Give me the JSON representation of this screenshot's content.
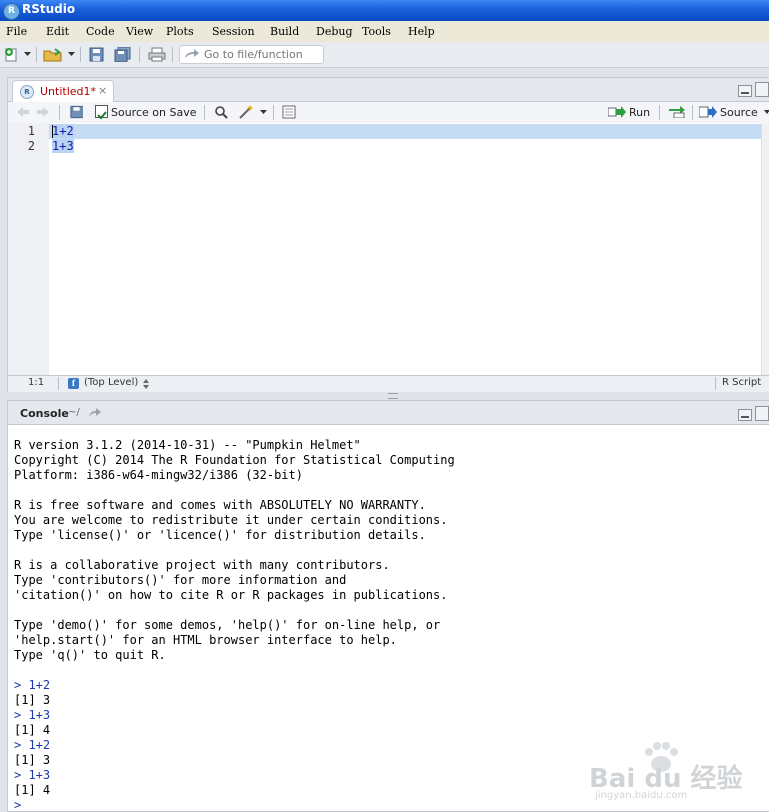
{
  "window": {
    "title": "RStudio",
    "app_icon_letter": "R"
  },
  "menu": [
    "File",
    "Edit",
    "Code",
    "View",
    "Plots",
    "Session",
    "Build",
    "Debug",
    "Tools",
    "Help"
  ],
  "toolbar": {
    "goto_placeholder": "Go to file/function"
  },
  "source": {
    "tab_label": "Untitled1*",
    "tab_close": "×",
    "source_on_save_label": "Source on Save",
    "source_on_save_checked": true,
    "run_label": "Run",
    "source_label": "Source",
    "line_numbers": [
      "1",
      "2"
    ],
    "code_lines": [
      "1+2",
      "1+3"
    ],
    "cursor_position": "1:1",
    "scope": "(Top Level)",
    "file_type": "R Script"
  },
  "console": {
    "title": "Console",
    "path": "~/",
    "lines": [
      "R version 3.1.2 (2014-10-31) -- \"Pumpkin Helmet\"",
      "Copyright (C) 2014 The R Foundation for Statistical Computing",
      "Platform: i386-w64-mingw32/i386 (32-bit)",
      "",
      "R is free software and comes with ABSOLUTELY NO WARRANTY.",
      "You are welcome to redistribute it under certain conditions.",
      "Type 'license()' or 'licence()' for distribution details.",
      "",
      "R is a collaborative project with many contributors.",
      "Type 'contributors()' for more information and",
      "'citation()' on how to cite R or R packages in publications.",
      "",
      "Type 'demo()' for some demos, 'help()' for on-line help, or",
      "'help.start()' for an HTML browser interface to help.",
      "Type 'q()' to quit R.",
      "",
      "> 1+2",
      "[1] 3",
      "> 1+3",
      "[1] 4",
      "> 1+2",
      "[1] 3",
      "> 1+3",
      "[1] 4",
      "> "
    ]
  },
  "watermark": {
    "brand": "Bai du 经验",
    "url": "jingyan.baidu.com"
  },
  "colors": {
    "titlebar": "#0a49c2",
    "line_highlight": "#c6dcf5",
    "command_text": "#1c3aa8",
    "tab_label": "#b30000"
  }
}
